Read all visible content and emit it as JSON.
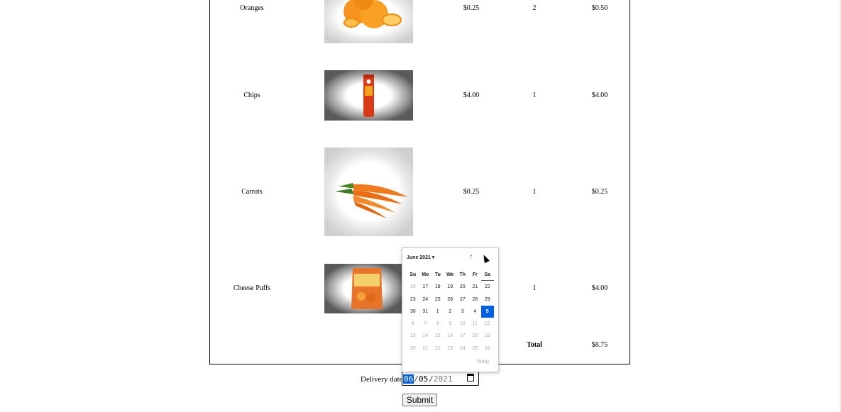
{
  "cart": {
    "rows": [
      {
        "name": "Oranges",
        "price": "$0.25",
        "qty": "2",
        "subtotal": "$0.50",
        "image": "oranges-image"
      },
      {
        "name": "Chips",
        "price": "$4.00",
        "qty": "1",
        "subtotal": "$4.00",
        "image": "chips-image"
      },
      {
        "name": "Carrots",
        "price": "$0.25",
        "qty": "1",
        "subtotal": "$0.25",
        "image": "carrots-image"
      },
      {
        "name": "Cheese Puffs",
        "price": "",
        "qty": "1",
        "subtotal": "$4.00",
        "image": "cheese-puffs-image"
      }
    ],
    "total_label": "Total",
    "total_value": "$8.75"
  },
  "delivery": {
    "label": "Delivery date",
    "month": "06",
    "day": "05",
    "year": "2021",
    "separator": "/"
  },
  "submit_label": "Submit",
  "datepicker": {
    "month_label": "June 2021 ▾",
    "up_arrow": "↑",
    "down_arrow": "↓",
    "weekdays": [
      "Su",
      "Mo",
      "Tu",
      "We",
      "Th",
      "Fr",
      "Sa"
    ],
    "weeks": [
      [
        "16",
        "17",
        "18",
        "19",
        "20",
        "21",
        "22"
      ],
      [
        "23",
        "24",
        "25",
        "26",
        "27",
        "28",
        "29"
      ],
      [
        "30",
        "31",
        "1",
        "2",
        "3",
        "4",
        "5"
      ],
      [
        "6",
        "7",
        "8",
        "9",
        "10",
        "11",
        "12"
      ],
      [
        "13",
        "14",
        "15",
        "16",
        "17",
        "18",
        "19"
      ],
      [
        "20",
        "21",
        "22",
        "23",
        "24",
        "25",
        "26"
      ]
    ],
    "selected_day": "5",
    "today_label": "Today"
  },
  "colors": {
    "accent": "#0060df",
    "border": "#000000",
    "muted_text": "#aaaaaa"
  }
}
